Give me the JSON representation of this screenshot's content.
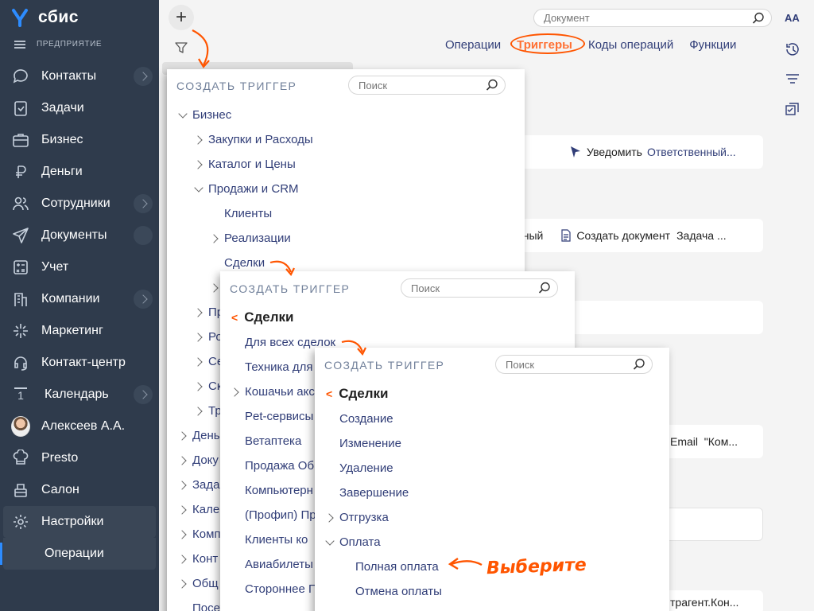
{
  "app": {
    "logo_text": "сбис",
    "enterprise_label": "ПРЕДПРИЯТИЕ"
  },
  "sidebar": {
    "items": [
      {
        "label": "Контакты",
        "icon": "chat-icon",
        "has_chevron": true
      },
      {
        "label": "Задачи",
        "icon": "task-icon",
        "has_chevron": false
      },
      {
        "label": "Бизнес",
        "icon": "briefcase-icon",
        "has_chevron": false
      },
      {
        "label": "Деньги",
        "icon": "money-icon",
        "has_chevron": false
      },
      {
        "label": "Сотрудники",
        "icon": "people-icon",
        "has_chevron": true
      },
      {
        "label": "Документы",
        "icon": "send-icon",
        "has_chevron": false
      },
      {
        "label": "Учет",
        "icon": "calculator-icon",
        "has_chevron": false
      },
      {
        "label": "Компании",
        "icon": "building-icon",
        "has_chevron": true
      },
      {
        "label": "Маркетинг",
        "icon": "sparkle-icon",
        "has_chevron": false
      },
      {
        "label": "Контакт-центр",
        "icon": "headset-icon",
        "has_chevron": false
      },
      {
        "label": "Календарь",
        "icon": "calendar-icon",
        "has_chevron": true,
        "icon_text": "1"
      },
      {
        "label": "Алексеев А.А.",
        "icon": "avatar",
        "has_chevron": false
      },
      {
        "label": "Presto",
        "icon": "chef-icon",
        "has_chevron": false
      },
      {
        "label": "Салон",
        "icon": "salon-icon",
        "has_chevron": false
      },
      {
        "label": "Настройки",
        "icon": "gear-icon",
        "has_chevron": false,
        "active": true
      }
    ],
    "sub_item": "Операции"
  },
  "header": {
    "search_placeholder": "Документ",
    "font_button": "AA",
    "tabs": [
      "Операции",
      "Триггеры",
      "Коды операций",
      "Функции"
    ],
    "active_tab": "Триггеры"
  },
  "background_cards": {
    "card1": {
      "action": "Уведомить",
      "target": "Ответственный..."
    },
    "card2": {
      "partial": "нный",
      "action": "Создать документ",
      "target": "Задача ..."
    },
    "card3": {
      "text": "Email  \"Ком..."
    },
    "card4": {
      "text": "трагент.Кон..."
    }
  },
  "popup1": {
    "title": "СОЗДАТЬ ТРИГГЕР",
    "search_placeholder": "Поиск",
    "items": [
      {
        "label": "Бизнес",
        "level": 0,
        "arrow": "down"
      },
      {
        "label": "Закупки и Расходы",
        "level": 1,
        "arrow": "right"
      },
      {
        "label": "Каталог и Цены",
        "level": 1,
        "arrow": "right"
      },
      {
        "label": "Продажи и CRM",
        "level": 1,
        "arrow": "down"
      },
      {
        "label": "Клиенты",
        "level": 2,
        "arrow": "none"
      },
      {
        "label": "Реализации",
        "level": 2,
        "arrow": "right"
      },
      {
        "label": "Сделки",
        "level": 2,
        "arrow": "none"
      },
      {
        "label": "",
        "level": 2,
        "arrow": "right"
      },
      {
        "label": "Пр",
        "level": 1,
        "arrow": "right"
      },
      {
        "label": "Ро",
        "level": 1,
        "arrow": "right"
      },
      {
        "label": "Се",
        "level": 1,
        "arrow": "right"
      },
      {
        "label": "Ск",
        "level": 1,
        "arrow": "right"
      },
      {
        "label": "Тр",
        "level": 1,
        "arrow": "right"
      },
      {
        "label": "День",
        "level": 0,
        "arrow": "right"
      },
      {
        "label": "Доку",
        "level": 0,
        "arrow": "right"
      },
      {
        "label": "Зада",
        "level": 0,
        "arrow": "right"
      },
      {
        "label": "Кале",
        "level": 0,
        "arrow": "right"
      },
      {
        "label": "Комп",
        "level": 0,
        "arrow": "right"
      },
      {
        "label": "Конт",
        "level": 0,
        "arrow": "right"
      },
      {
        "label": "Общ",
        "level": 0,
        "arrow": "right"
      },
      {
        "label": "Посетители сайта",
        "level": 0,
        "arrow": "none"
      }
    ]
  },
  "popup2": {
    "title": "СОЗДАТЬ ТРИГГЕР",
    "search_placeholder": "Поиск",
    "back_label": "Сделки",
    "items": [
      {
        "label": "Для всех сделок",
        "arrow": "none"
      },
      {
        "label": "Техника для",
        "arrow": "none"
      },
      {
        "label": "Кошачьи акс",
        "arrow": "right"
      },
      {
        "label": "Pet-сервисы",
        "arrow": "none"
      },
      {
        "label": "Ветаптека",
        "arrow": "none"
      },
      {
        "label": "Продажа Об",
        "arrow": "none"
      },
      {
        "label": "Компьютерн",
        "arrow": "none"
      },
      {
        "label": "(Профип) Пр",
        "arrow": "none"
      },
      {
        "label": "Клиенты ко",
        "arrow": "none"
      },
      {
        "label": "Авиабилеты",
        "arrow": "none"
      },
      {
        "label": "Стороннее П",
        "arrow": "none"
      }
    ]
  },
  "popup3": {
    "title": "СОЗДАТЬ ТРИГГЕР",
    "search_placeholder": "Поиск",
    "back_label": "Сделки",
    "items": [
      {
        "label": "Создание",
        "level": 0,
        "arrow": "none"
      },
      {
        "label": "Изменение",
        "level": 0,
        "arrow": "none"
      },
      {
        "label": "Удаление",
        "level": 0,
        "arrow": "none"
      },
      {
        "label": "Завершение",
        "level": 0,
        "arrow": "none"
      },
      {
        "label": "Отгрузка",
        "level": 0,
        "arrow": "right"
      },
      {
        "label": "Оплата",
        "level": 0,
        "arrow": "down"
      },
      {
        "label": "Полная оплата",
        "level": 1,
        "arrow": "none"
      },
      {
        "label": "Отмена оплаты",
        "level": 1,
        "arrow": "none"
      }
    ]
  },
  "annotation": {
    "text": "Выберите"
  },
  "colors": {
    "sidebar_bg": "#2f3b4c",
    "accent": "#ff5500",
    "text_primary": "#313e78",
    "logo_blue": "#2d8cff"
  }
}
